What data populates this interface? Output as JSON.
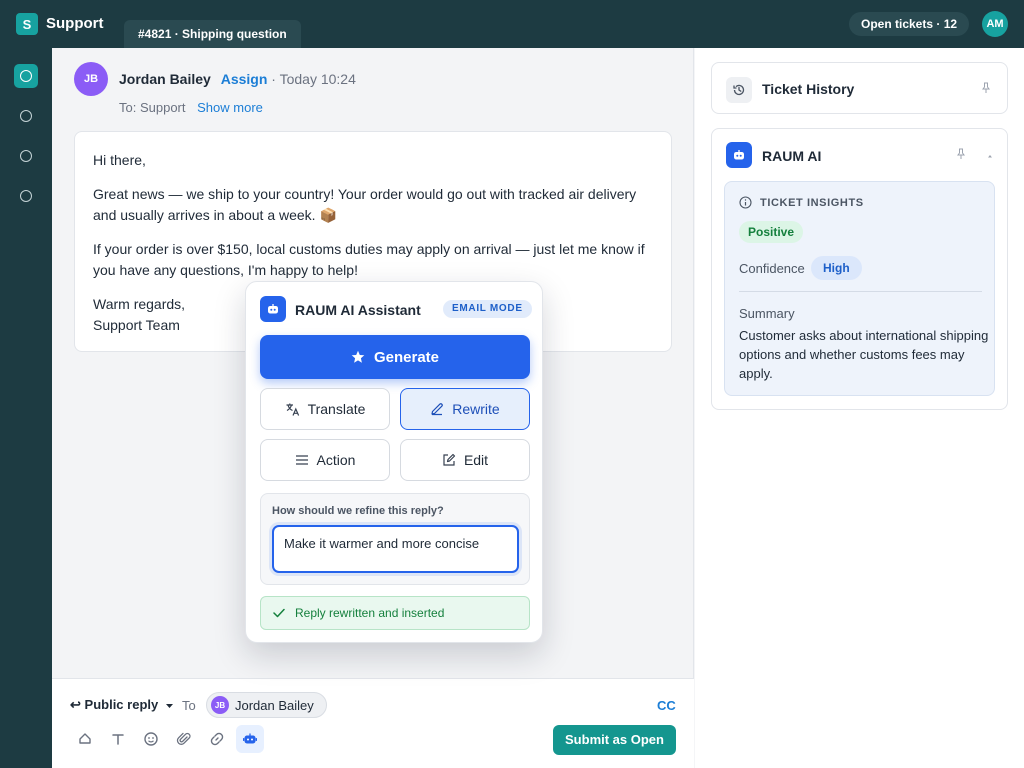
{
  "app": {
    "logo_letter": "S",
    "name": "Support"
  },
  "tab": {
    "label": "#4821 · Shipping question"
  },
  "header": {
    "open_tickets": "Open tickets · 12",
    "user_initials": "AM"
  },
  "rail": {
    "items": [
      "home-icon",
      "circle-icon",
      "circle-icon",
      "circle-icon"
    ]
  },
  "message": {
    "avatar_initials": "JB",
    "sender": "Jordan Bailey",
    "assign_label": "Assign",
    "time": " · Today 10:24",
    "to": "To: Support",
    "show_more": "Show more",
    "body": {
      "greeting": "Hi there,",
      "p1": "Great news — we ship to your country! Your order would go out with tracked air delivery and usually arrives in about a week. 📦",
      "p2": "If your order is over $150, local customs duties may apply on arrival — just let me know if you have any questions, I'm happy to help!",
      "sign_1": "Warm regards,",
      "sign_2": "Support Team"
    }
  },
  "composer": {
    "reply_type": "Public reply",
    "to_label": "To",
    "recipient_initials": "JB",
    "recipient": "Jordan Bailey",
    "cc": "CC",
    "submit": "Submit as Open"
  },
  "right_panel": {
    "history_title": "Ticket History",
    "ai_title": "RAUM AI",
    "insights": {
      "heading": "TICKET INSIGHTS",
      "sentiment": "Positive",
      "confidence_label": "Confidence",
      "confidence": "High",
      "summary_label": "Summary",
      "summary": "Customer asks about international shipping options and whether customs fees may apply."
    }
  },
  "assistant": {
    "title": "RAUM AI Assistant",
    "mode": "EMAIL MODE",
    "generate": "Generate",
    "options": {
      "translate": "Translate",
      "rewrite": "Rewrite",
      "action": "Action",
      "edit": "Edit"
    },
    "selected_option": "Rewrite",
    "refine_label": "How should we refine this reply?",
    "refine_value": "Make it warmer and more concise",
    "status": "Reply rewritten and inserted"
  },
  "colors": {
    "primary": "#2563eb",
    "teal": "#14968f",
    "topbar": "#1d3b42",
    "success": "#15803d"
  }
}
